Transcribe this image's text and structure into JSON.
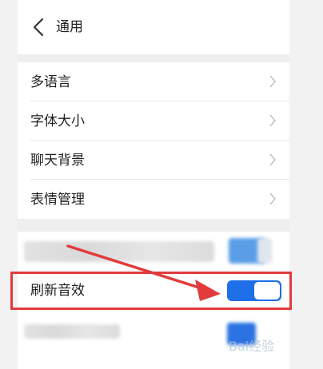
{
  "header": {
    "title": "通用",
    "back_icon": "chevron-left-icon"
  },
  "settings": {
    "items": [
      {
        "label": "多语言"
      },
      {
        "label": "字体大小"
      },
      {
        "label": "聊天背景"
      },
      {
        "label": "表情管理"
      }
    ]
  },
  "toggles": {
    "refresh_sound": {
      "label": "刷新音效",
      "state": "on"
    }
  },
  "colors": {
    "accent": "#1e6fe8",
    "highlight": "#e23b3b"
  },
  "watermark": {
    "text": "Bai经验"
  }
}
